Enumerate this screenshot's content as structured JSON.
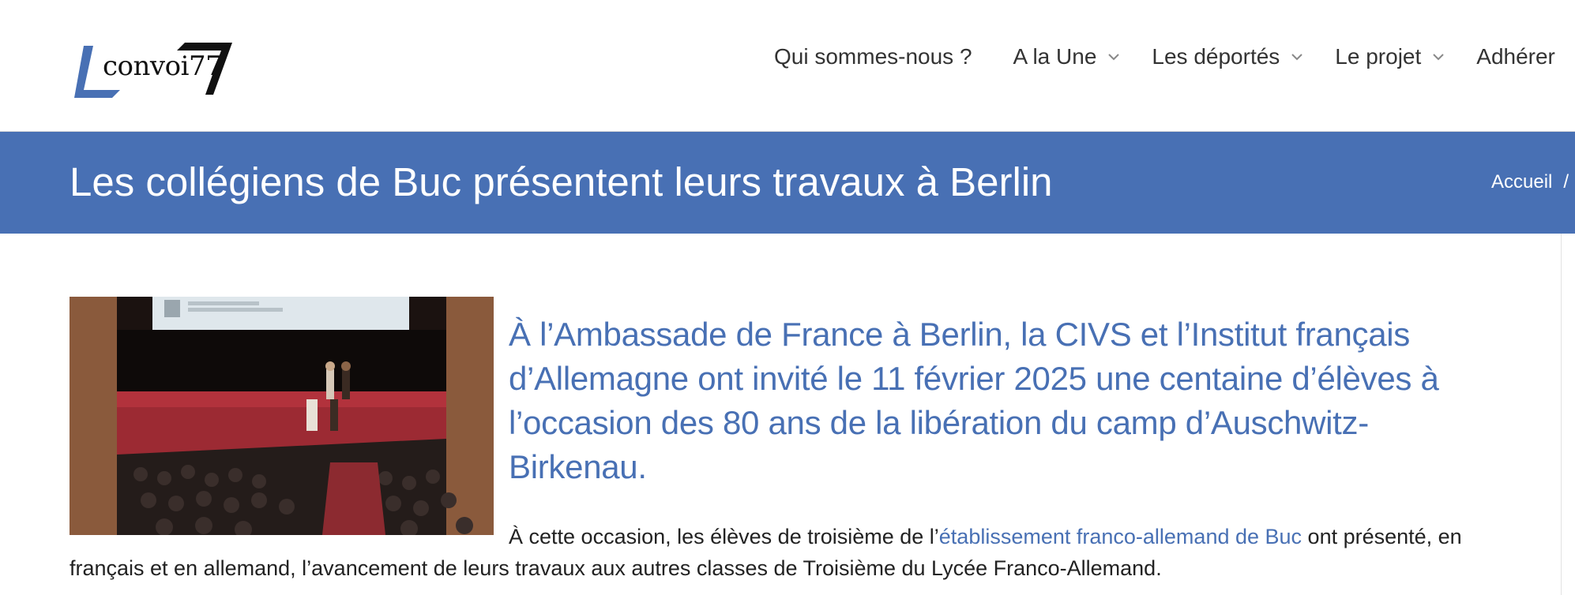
{
  "header": {
    "logo_text": "convoi77",
    "nav": [
      {
        "label": "Qui sommes-nous ?",
        "has_dropdown": false
      },
      {
        "label": "A la Une",
        "has_dropdown": true
      },
      {
        "label": "Les déportés",
        "has_dropdown": true
      },
      {
        "label": "Le projet",
        "has_dropdown": true
      },
      {
        "label": "Adhérer",
        "has_dropdown": false
      }
    ]
  },
  "banner": {
    "title": "Les collégiens de Buc présentent leurs travaux à Berlin",
    "breadcrumb_home": "Accueil",
    "breadcrumb_sep": "/"
  },
  "article": {
    "lead": "À l’Ambassade de France à Berlin, la CIVS et l’Institut français d’Allemagne ont invité le 11 février 2025 une centaine d’élèves à l’occasion des 80 ans de la libération du camp d’Auschwitz-Birkenau.",
    "body_before_link": "À cette occasion, les élèves de troisième de l’",
    "body_link": "établissement franco-allemand de Buc",
    "body_after_link": " ont présenté, en français et en allemand, l’avancement de leurs travaux aux autres classes de Troisième du Lycée Franco-Allemand."
  },
  "colors": {
    "brand_blue": "#4870b4",
    "text": "#222222"
  }
}
